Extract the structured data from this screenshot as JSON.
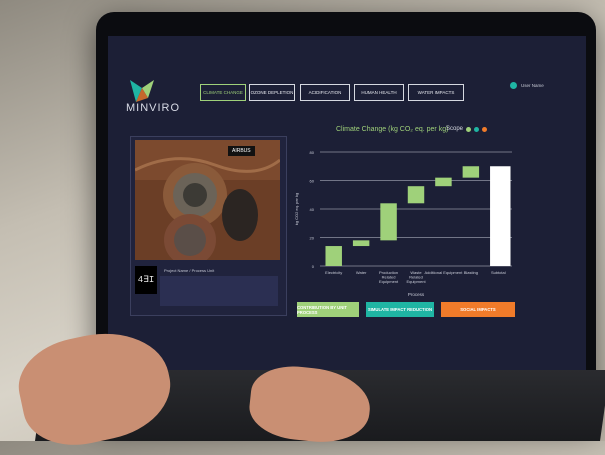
{
  "app": {
    "logo_text": "MINVIRO",
    "user_name": "User Name"
  },
  "nav": {
    "tabs": [
      {
        "label": "CLIMATE CHANGE",
        "active": true
      },
      {
        "label": "OZONE DEPLETION",
        "active": false
      },
      {
        "label": "ACIDIFICATION",
        "active": false
      },
      {
        "label": "HUMAN HEALTH",
        "active": false
      },
      {
        "label": "WATER IMPACTS",
        "active": false
      }
    ]
  },
  "image_panel": {
    "badge": "AIRBUS",
    "thumb_text": "4∃I",
    "caption": "Project Name / Process Unit"
  },
  "chart_header": {
    "title": "Climate Change (kg CO₂ eq. per kg)",
    "scope_label": "Scope"
  },
  "scope_colors": [
    "#9fd17a",
    "#1fb5a3",
    "#f07b2a"
  ],
  "chart_data": {
    "type": "bar",
    "categories": [
      "Electricity",
      "Water",
      "Production Related Equipment",
      "Waste Related Equipment",
      "Additional Equipment",
      "Blasting",
      "Subtotal"
    ],
    "series": [
      {
        "values": [
          [
            0,
            14
          ],
          [
            14,
            18
          ],
          [
            18,
            44
          ],
          [
            44,
            56
          ],
          [
            56,
            62
          ],
          [
            62,
            70
          ],
          [
            0,
            70
          ]
        ]
      }
    ],
    "xlabel": "Process",
    "ylabel": "kg CO2 eq. per kg",
    "yticks": [
      0,
      20,
      40,
      60,
      80
    ],
    "ylim": [
      0,
      80
    ],
    "bar_color": "#9fd17a",
    "subtotal_color": "#ffffff",
    "grid": true
  },
  "buttons": [
    {
      "label": "CONTRIBUTION BY UNIT PROCESS",
      "color": "#9fd17a"
    },
    {
      "label": "SIMULATE IMPACT REDUCTION",
      "color": "#1fb5a3"
    },
    {
      "label": "SOCIAL IMPACTS",
      "color": "#f07b2a"
    }
  ]
}
